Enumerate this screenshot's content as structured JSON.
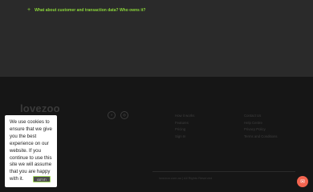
{
  "faq": {
    "icon": "plus-icon",
    "question": "What about customer and transaction data? Who owns it?"
  },
  "footer": {
    "logo_text": "lovezoo",
    "social": [
      {
        "icon": "facebook-icon",
        "glyph": "f"
      },
      {
        "icon": "instagram-icon",
        "glyph": "◎"
      }
    ],
    "links_col1": [
      "How it works",
      "Features",
      "Pricing",
      "Sign In"
    ],
    "links_col2": [
      "Contact Us",
      "Help Centre",
      "Privacy Policy",
      "Terms and Conditions"
    ],
    "copyright": "lovezoo.com.au | All Rights Reserved"
  },
  "cookie": {
    "message": "We use cookies to ensure that we give you the best experience on our website. If you continue to use this site we will assume that you are happy with it.",
    "button_label": "GOT IT!"
  },
  "chat": {
    "icon": "chat-icon",
    "color": "#f3644f"
  },
  "colors": {
    "accent": "#8bd63a",
    "footer_bg": "#161616",
    "top_bg": "#2a2a2a"
  }
}
